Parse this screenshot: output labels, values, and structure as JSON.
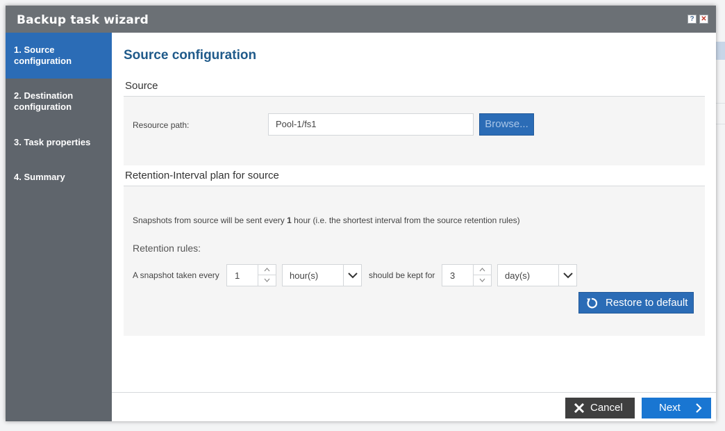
{
  "window": {
    "title": "Backup task wizard",
    "help_glyph": "?",
    "close_glyph": "✕"
  },
  "steps": [
    {
      "label": "1. Source configuration",
      "active": true
    },
    {
      "label": "2. Destination configuration",
      "active": false
    },
    {
      "label": "3. Task properties",
      "active": false
    },
    {
      "label": "4. Summary",
      "active": false
    }
  ],
  "main": {
    "title": "Source configuration",
    "source": {
      "heading": "Source",
      "resource_label": "Resource path:",
      "resource_value": "Pool-1/fs1",
      "browse_label": "Browse..."
    },
    "retention": {
      "heading": "Retention-Interval plan for source",
      "info_prefix": "Snapshots from source will be sent every ",
      "info_value": "1",
      "info_suffix": " hour (i.e. the shortest interval from the source retention rules)",
      "rules_label": "Retention rules:",
      "rule_prefix": "A snapshot taken every",
      "interval_value": "1",
      "interval_unit": "hour(s)",
      "kept_label": "should be kept for",
      "kept_value": "3",
      "kept_unit": "day(s)",
      "restore_label": "Restore to default"
    }
  },
  "footer": {
    "cancel_label": "Cancel",
    "next_label": "Next"
  },
  "colors": {
    "accent": "#2b6cb6",
    "sidebar": "#5f656c",
    "titlebar": "#6b7075",
    "next": "#1976d2",
    "cancel": "#3f3f3f"
  }
}
